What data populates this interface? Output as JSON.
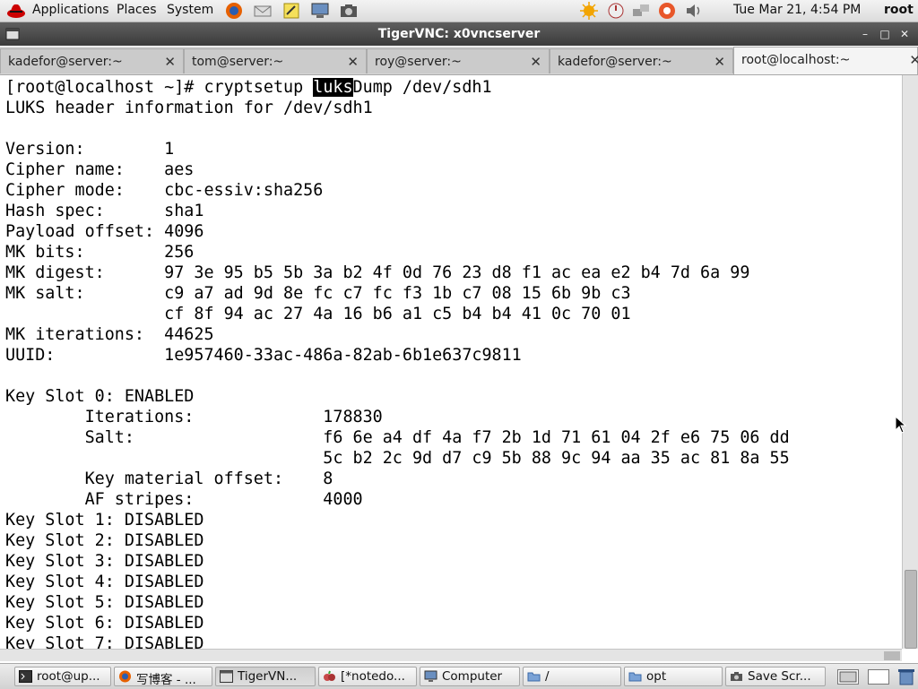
{
  "top_panel": {
    "menus": [
      "Applications",
      "Places",
      "System"
    ],
    "clock": "Tue Mar 21,  4:54 PM",
    "user": "root"
  },
  "window": {
    "title": "TigerVNC: x0vncserver"
  },
  "tabs": [
    {
      "label": "kadefor@server:~",
      "active": false
    },
    {
      "label": "tom@server:~",
      "active": false
    },
    {
      "label": "roy@server:~",
      "active": false
    },
    {
      "label": "kadefor@server:~",
      "active": false
    },
    {
      "label": "root@localhost:~",
      "active": true
    }
  ],
  "terminal": {
    "command_prompt": "[root@localhost ~]# cryptsetup ",
    "command_selected": "luks",
    "command_rest": "Dump /dev/sdh1",
    "body": "LUKS header information for /dev/sdh1\n\nVersion:        1\nCipher name:    aes\nCipher mode:    cbc-essiv:sha256\nHash spec:      sha1\nPayload offset: 4096\nMK bits:        256\nMK digest:      97 3e 95 b5 5b 3a b2 4f 0d 76 23 d8 f1 ac ea e2 b4 7d 6a 99\nMK salt:        c9 a7 ad 9d 8e fc c7 fc f3 1b c7 08 15 6b 9b c3\n                cf 8f 94 ac 27 4a 16 b6 a1 c5 b4 b4 41 0c 70 01\nMK iterations:  44625\nUUID:           1e957460-33ac-486a-82ab-6b1e637c9811\n\nKey Slot 0: ENABLED\n        Iterations:             178830\n        Salt:                   f6 6e a4 df 4a f7 2b 1d 71 61 04 2f e6 75 06 dd\n                                5c b2 2c 9d d7 c9 5b 88 9c 94 aa 35 ac 81 8a 55\n        Key material offset:    8\n        AF stripes:             4000\nKey Slot 1: DISABLED\nKey Slot 2: DISABLED\nKey Slot 3: DISABLED\nKey Slot 4: DISABLED\nKey Slot 5: DISABLED\nKey Slot 6: DISABLED\nKey Slot 7: DISABLED"
  },
  "taskbar": [
    {
      "label": "root@up...",
      "icon": "terminal-icon",
      "active": false
    },
    {
      "label": "写博客 - ...",
      "icon": "firefox-icon",
      "active": false
    },
    {
      "label": "TigerVN...",
      "icon": "window-icon",
      "active": true
    },
    {
      "label": "[*notedo...",
      "icon": "notes-icon",
      "active": false
    },
    {
      "label": "Computer",
      "icon": "computer-icon",
      "active": false
    },
    {
      "label": "/",
      "icon": "folder-icon",
      "active": false
    },
    {
      "label": "opt",
      "icon": "folder-icon",
      "active": false
    },
    {
      "label": "Save Scr...",
      "icon": "camera-icon",
      "active": false
    }
  ],
  "colors": {
    "panel_bg": "#dcdcdc",
    "titlebar_bg": "#3b3b3b",
    "terminal_bg": "#ffffff",
    "terminal_fg": "#000000",
    "selection_bg": "#000000"
  }
}
